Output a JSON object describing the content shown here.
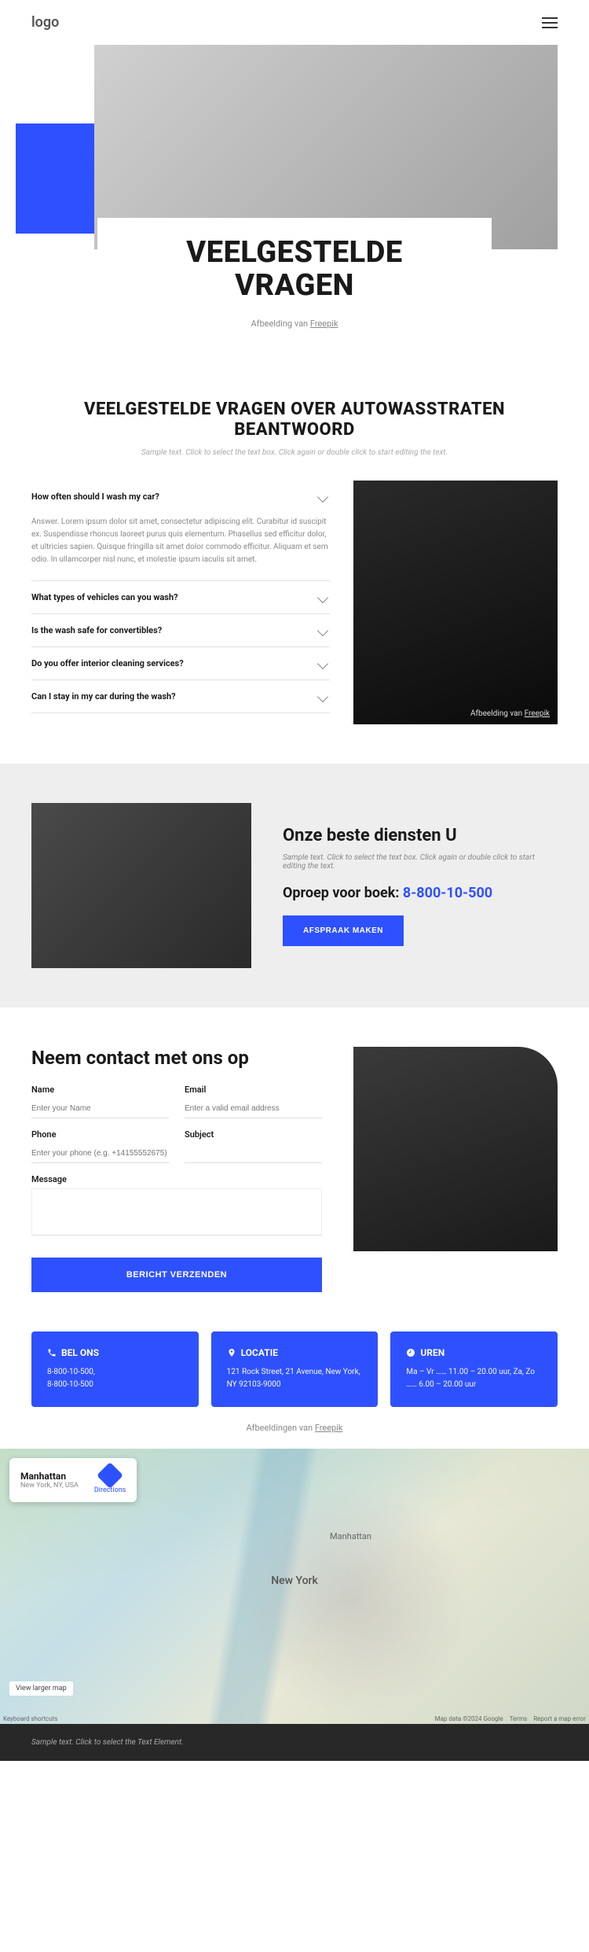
{
  "header": {
    "logo": "logo"
  },
  "hero": {
    "title": "VEELGESTELDE VRAGEN",
    "credit_prefix": "Afbeelding van ",
    "credit_link": "Freepik"
  },
  "faq": {
    "heading": "VEELGESTELDE VRAGEN OVER AUTOWASSTRATEN BEANTWOORD",
    "subtext": "Sample text. Click to select the text box. Click again or double click to start editing the text.",
    "items": [
      {
        "q": "How often should I wash my car?",
        "a": "Answer. Lorem ipsum dolor sit amet, consectetur adipiscing elit. Curabitur id suscipit ex. Suspendisse rhoncus laoreet purus quis elementum. Phasellus sed efficitur dolor, et ultricies sapien. Quisque fringilla sit amet dolor commodo efficitur. Aliquam et sem odio. In ullamcorper nisl nunc, et molestie ipsum iaculis sit amet."
      },
      {
        "q": "What types of vehicles can you wash?"
      },
      {
        "q": "Is the wash safe for convertibles?"
      },
      {
        "q": "Do you offer interior cleaning services?"
      },
      {
        "q": "Can I stay in my car during the wash?"
      }
    ],
    "image_credit_prefix": "Afbeelding van ",
    "image_credit_link": "Freepik"
  },
  "services": {
    "title": "Onze beste diensten U",
    "subtext": "Sample text. Click to select the text box. Click again or double click to start editing the text.",
    "call_label": "Oproep voor boek: ",
    "phone": "8-800-10-500",
    "button": "AFSPRAAK MAKEN"
  },
  "contact": {
    "title": "Neem contact met ons op",
    "fields": {
      "name": {
        "label": "Name",
        "placeholder": "Enter your Name"
      },
      "email": {
        "label": "Email",
        "placeholder": "Enter a valid email address"
      },
      "phone": {
        "label": "Phone",
        "placeholder": "Enter your phone (e.g. +14155552675)"
      },
      "subject": {
        "label": "Subject",
        "placeholder": ""
      },
      "message": {
        "label": "Message",
        "placeholder": ""
      }
    },
    "submit": "BERICHT VERZENDEN"
  },
  "info_cards": [
    {
      "icon": "phone",
      "title": "BEL ONS",
      "text": "8-800-10-500,\n8-800-10-500"
    },
    {
      "icon": "pin",
      "title": "LOCATIE",
      "text": "121 Rock Street, 21 Avenue, New York, NY 92103-9000"
    },
    {
      "icon": "clock",
      "title": "UREN",
      "text": "Ma – Vr …… 11.00 – 20.00 uur, Za, Zo …… 6.00 – 20.00 uur"
    }
  ],
  "images_credit": {
    "prefix": "Afbeeldingen van ",
    "link": "Freepik"
  },
  "map": {
    "card_title": "Manhattan",
    "card_sub": "New York, NY, USA",
    "directions": "Directions",
    "view_larger": "View larger map",
    "center_label": "New York",
    "mh_label": "Manhattan",
    "keyboard": "Keyboard shortcuts",
    "mapdata": "Map data ©2024 Google",
    "terms": "Terms",
    "report": "Report a map error"
  },
  "footer": {
    "text": "Sample text. Click to select the Text Element."
  }
}
